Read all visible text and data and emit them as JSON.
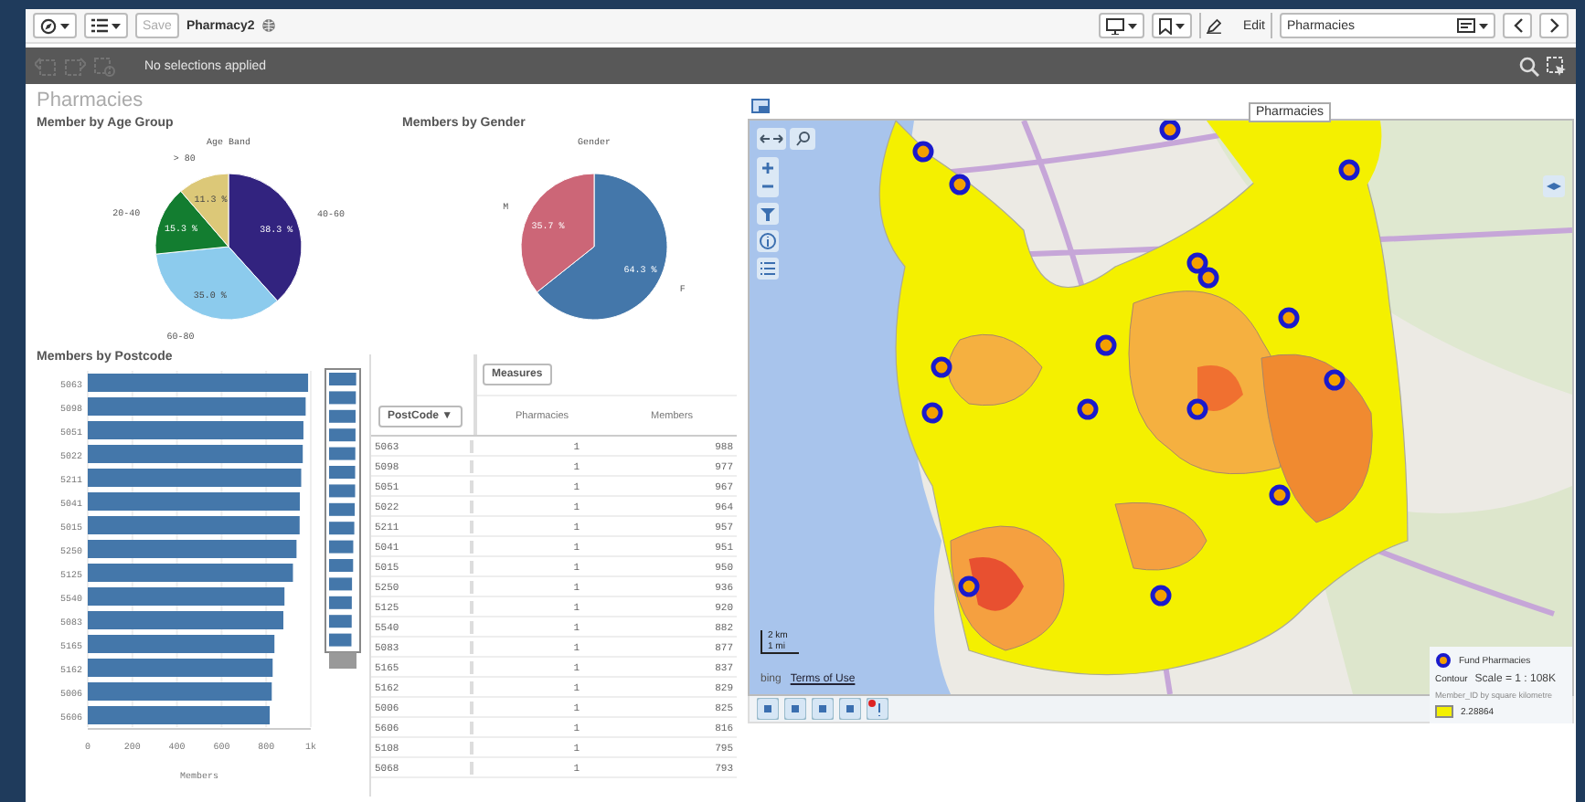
{
  "toolbar": {
    "app_name": "Pharmacy2",
    "save": "Save",
    "edit": "Edit",
    "sheet": "Pharmacies"
  },
  "selections_bar": {
    "text": "No selections applied"
  },
  "sheet": {
    "title": "Pharmacies"
  },
  "age_chart": {
    "title": "Member by Age Group",
    "chart_data": {
      "type": "pie",
      "title": "Age Band",
      "categories": [
        "40-60",
        "60-80",
        "20-40",
        "> 80"
      ],
      "values": [
        38.3,
        35.0,
        15.3,
        11.3
      ],
      "value_labels": [
        "38.3 %",
        "35.0 %",
        "15.3 %",
        "11.3 %"
      ],
      "colors": [
        "#32237f",
        "#8ccbed",
        "#137d30",
        "#dcc878"
      ]
    }
  },
  "gender_chart": {
    "title": "Members by Gender",
    "chart_data": {
      "type": "pie",
      "title": "Gender",
      "categories": [
        "F",
        "M"
      ],
      "values": [
        64.3,
        35.7
      ],
      "value_labels": [
        "64.3 %",
        "35.7 %"
      ],
      "colors": [
        "#4477aa",
        "#cc6677"
      ]
    }
  },
  "postcode_chart": {
    "title": "Members by Postcode",
    "chart_data": {
      "type": "bar",
      "orientation": "horizontal",
      "xlabel": "Members",
      "grid": true,
      "categories": [
        "5063",
        "5098",
        "5051",
        "5022",
        "5211",
        "5041",
        "5015",
        "5250",
        "5125",
        "5540",
        "5083",
        "5165",
        "5162",
        "5006",
        "5606"
      ],
      "values": [
        988,
        977,
        967,
        964,
        957,
        951,
        950,
        936,
        920,
        882,
        877,
        837,
        829,
        825,
        816
      ],
      "xlim": [
        0,
        1000
      ],
      "xticks": [
        {
          "value": 0,
          "label": "0"
        },
        {
          "value": 200,
          "label": "200"
        },
        {
          "value": 400,
          "label": "400"
        },
        {
          "value": 600,
          "label": "600"
        },
        {
          "value": 800,
          "label": "800"
        },
        {
          "value": 1000,
          "label": "1k"
        }
      ]
    }
  },
  "table": {
    "measures_button": "Measures",
    "dimension_button": "PostCode",
    "dimension_caret": "▼",
    "columns": [
      "Pharmacies",
      "Members"
    ],
    "rows": [
      [
        "5063",
        "1",
        "988"
      ],
      [
        "5098",
        "1",
        "977"
      ],
      [
        "5051",
        "1",
        "967"
      ],
      [
        "5022",
        "1",
        "964"
      ],
      [
        "5211",
        "1",
        "957"
      ],
      [
        "5041",
        "1",
        "951"
      ],
      [
        "5015",
        "1",
        "950"
      ],
      [
        "5250",
        "1",
        "936"
      ],
      [
        "5125",
        "1",
        "920"
      ],
      [
        "5540",
        "1",
        "882"
      ],
      [
        "5083",
        "1",
        "877"
      ],
      [
        "5165",
        "1",
        "837"
      ],
      [
        "5162",
        "1",
        "829"
      ],
      [
        "5006",
        "1",
        "825"
      ],
      [
        "5606",
        "1",
        "816"
      ],
      [
        "5108",
        "1",
        "795"
      ],
      [
        "5068",
        "1",
        "793"
      ]
    ]
  },
  "map": {
    "tooltip": "Pharmacies",
    "bing": "bing",
    "terms": "Terms of Use",
    "scale_km": "2 km",
    "scale_mi": "1 mi",
    "legend": {
      "pin_label": "Fund Pharmacies",
      "contour": "Contour",
      "scale": "Scale = 1 : 108K",
      "measure": "Member_ID by square kilometre",
      "value": "2.28864"
    }
  }
}
